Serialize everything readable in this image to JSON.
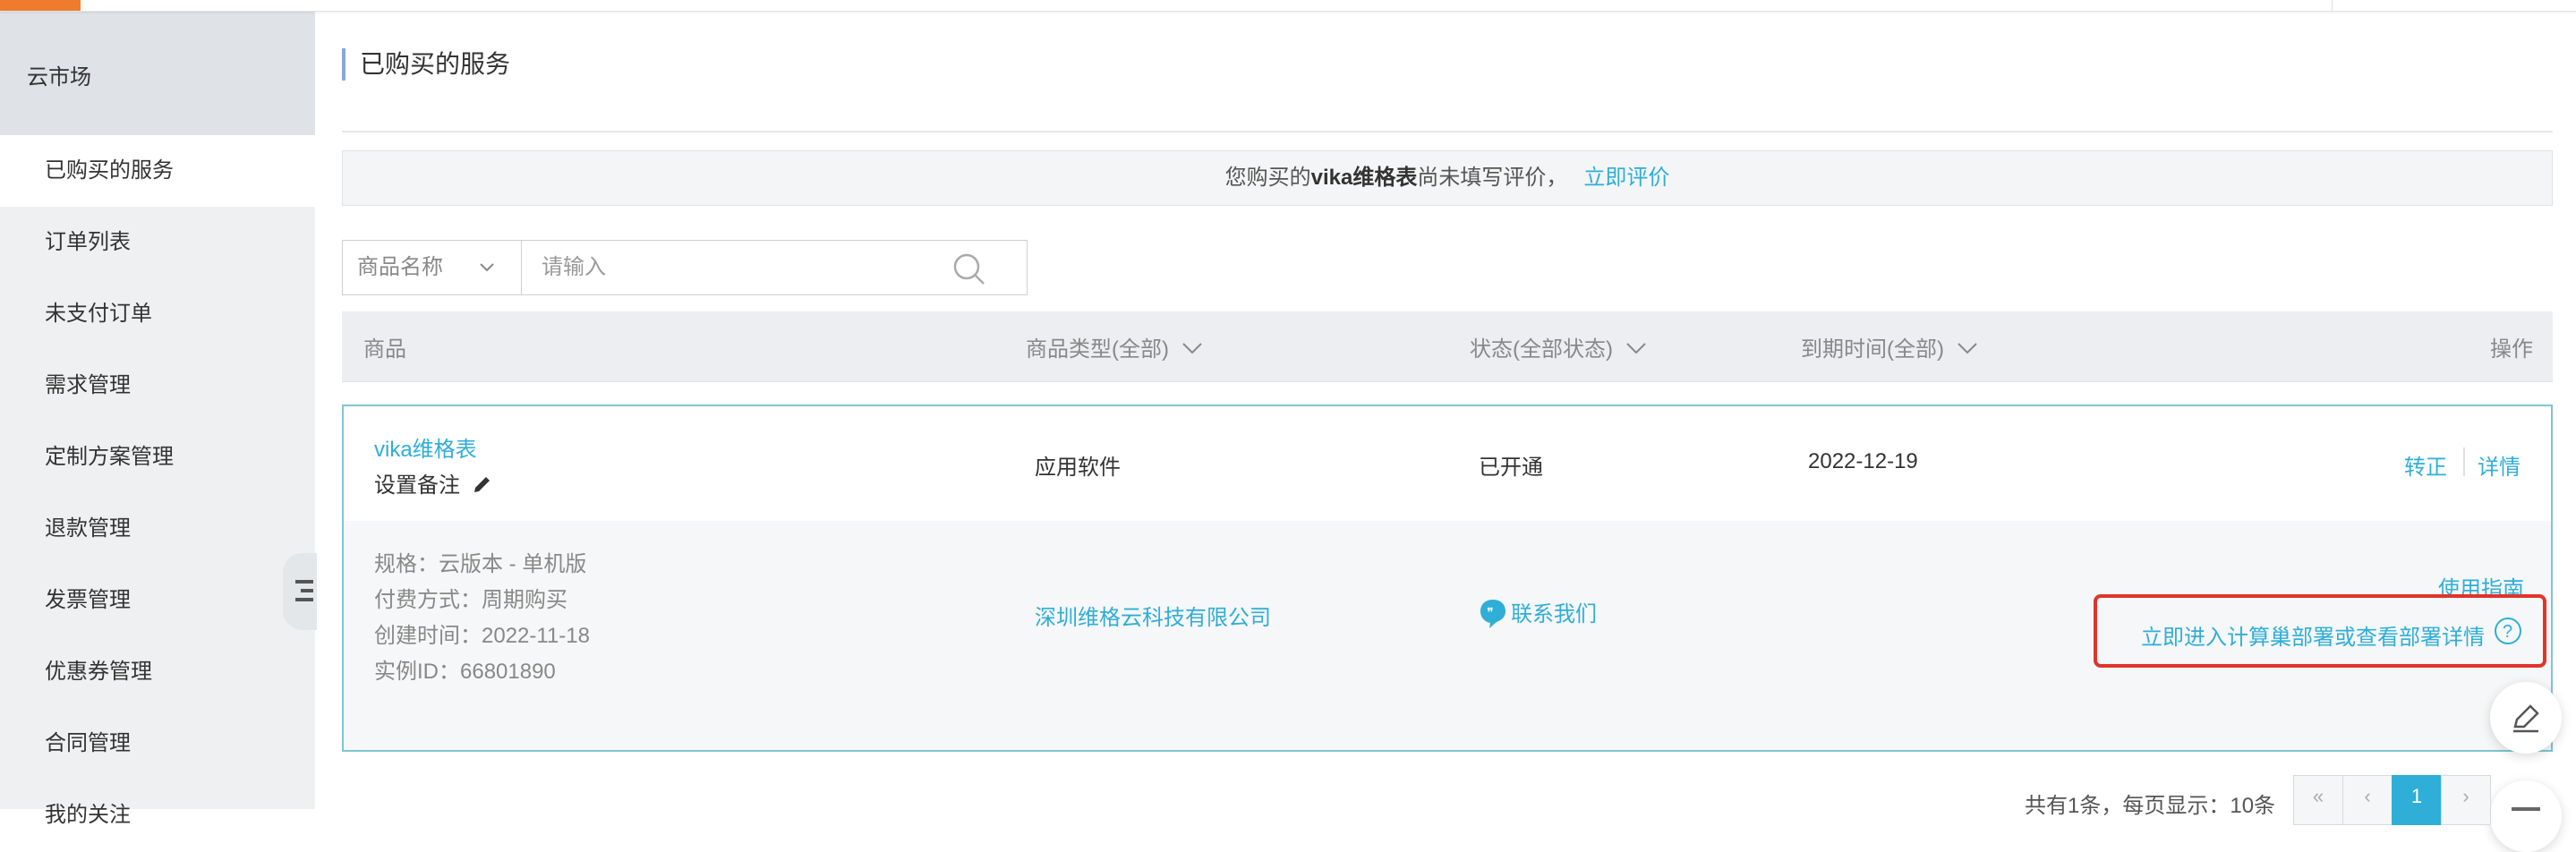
{
  "sidebar": {
    "header": "云市场",
    "items": [
      {
        "label": "已购买的服务",
        "active": true
      },
      {
        "label": "订单列表"
      },
      {
        "label": "未支付订单"
      },
      {
        "label": "需求管理"
      },
      {
        "label": "定制方案管理"
      },
      {
        "label": "退款管理"
      },
      {
        "label": "发票管理"
      },
      {
        "label": "优惠券管理"
      },
      {
        "label": "合同管理"
      },
      {
        "label": "我的关注"
      }
    ]
  },
  "page": {
    "title": "已购买的服务"
  },
  "notice": {
    "prefix": "您购买的",
    "product": "vika维格表",
    "suffix": "尚未填写评价，",
    "action": "立即评价"
  },
  "search": {
    "field_select": "商品名称",
    "placeholder": "请输入"
  },
  "table": {
    "headers": {
      "product": "商品",
      "category": "商品类型(全部)",
      "status": "状态(全部状态)",
      "expiry": "到期时间(全部)",
      "actions": "操作"
    },
    "row": {
      "product_name": "vika维格表",
      "set_note": "设置备注",
      "category": "应用软件",
      "status": "已开通",
      "expiry": "2022-12-19",
      "action_convert": "转正",
      "action_detail": "详情",
      "spec": "规格：云版本 - 单机版",
      "payment": "付费方式：周期购买",
      "created": "创建时间：2022-11-18",
      "instance": "实例ID：66801890",
      "vendor": "深圳维格云科技有限公司",
      "contact": "联系我们",
      "guide": "使用指南",
      "deploy": "立即进入计算巢部署或查看部署详情"
    }
  },
  "pagination": {
    "summary": "共有1条，每页显示：10条",
    "first": "«",
    "prev": "‹",
    "current": "1",
    "next": "›",
    "last": "»"
  },
  "colors": {
    "accent": "#2faed8",
    "highlight": "#e0342b",
    "brand": "#ef7b2c"
  },
  "icons": {
    "edit": "pencil-icon",
    "search": "magnifier-icon",
    "contact": "chat-bubble-icon",
    "help": "question-circle-icon",
    "feedback": "edit-pen-icon"
  }
}
